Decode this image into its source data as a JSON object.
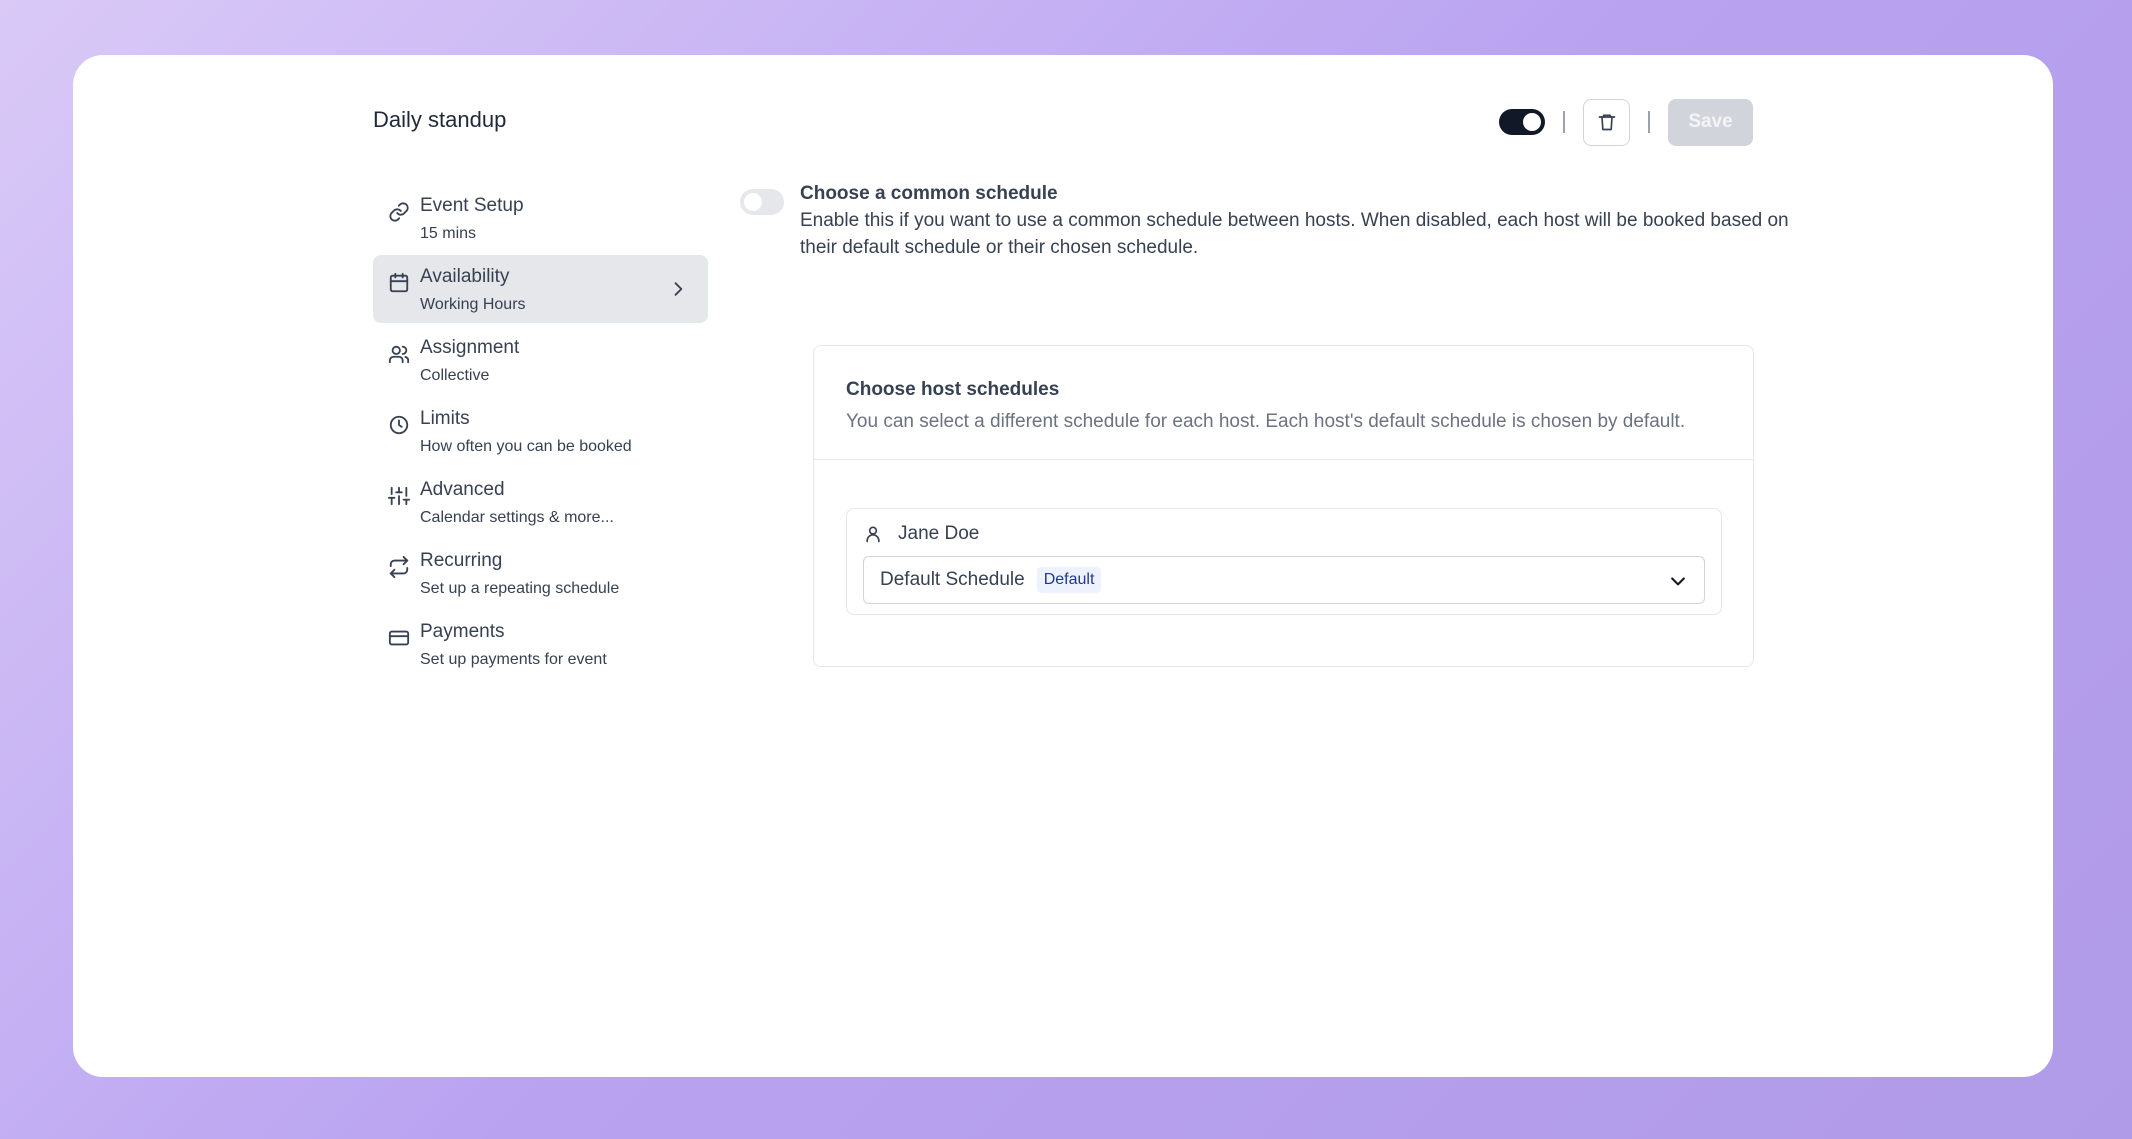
{
  "header": {
    "title": "Daily standup",
    "save_label": "Save"
  },
  "sidebar": {
    "items": [
      {
        "label": "Event Setup",
        "sub": "15 mins",
        "icon": "link-icon"
      },
      {
        "label": "Availability",
        "sub": "Working Hours",
        "icon": "calendar-icon",
        "active": true
      },
      {
        "label": "Assignment",
        "sub": "Collective",
        "icon": "users-icon"
      },
      {
        "label": "Limits",
        "sub": "How often you can be booked",
        "icon": "clock-icon"
      },
      {
        "label": "Advanced",
        "sub": "Calendar settings & more...",
        "icon": "sliders-icon"
      },
      {
        "label": "Recurring",
        "sub": "Set up a repeating schedule",
        "icon": "repeat-icon"
      },
      {
        "label": "Payments",
        "sub": "Set up payments for event",
        "icon": "credit-card-icon"
      }
    ]
  },
  "main": {
    "common_title": "Choose a common schedule",
    "common_desc": "Enable this if you want to use a common schedule between hosts. When disabled, each host will be booked based on their default schedule or their chosen schedule.",
    "host_title": "Choose host schedules",
    "host_desc": "You can select a different schedule for each host. Each host's default schedule is chosen by default.",
    "host": {
      "name": "Jane Doe",
      "schedule": "Default Schedule",
      "badge": "Default"
    }
  },
  "colors": {
    "accent": "#111827",
    "active_bg": "#e5e7eb",
    "badge_bg": "#eef2ff",
    "badge_text": "#1e3a8a"
  }
}
